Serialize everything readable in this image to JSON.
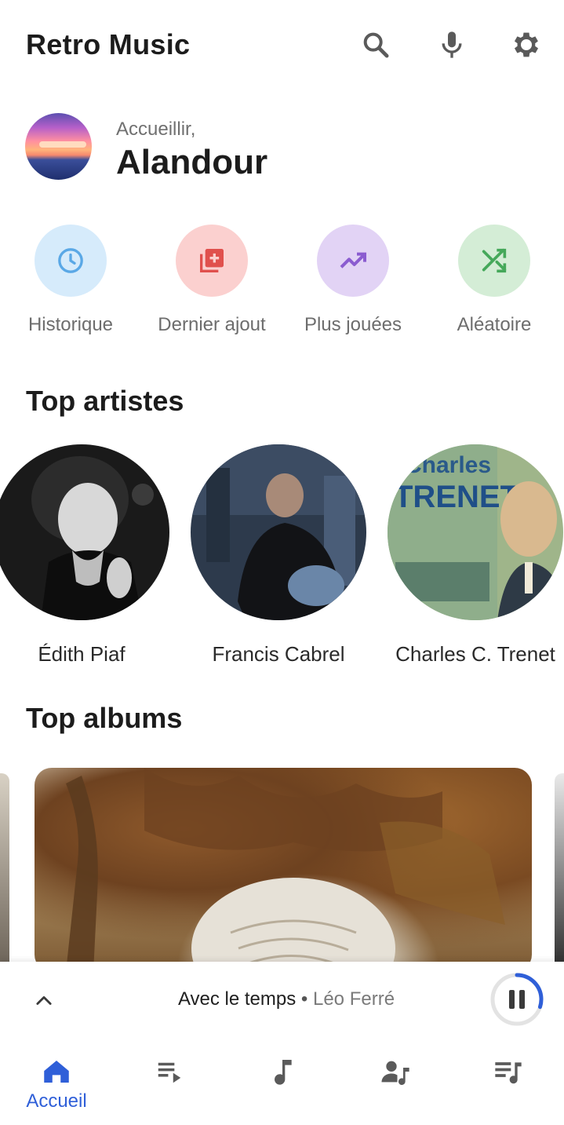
{
  "app": {
    "title": "Retro Music"
  },
  "header": {
    "icons": [
      "search-icon",
      "microphone-icon",
      "settings-gear-icon"
    ]
  },
  "greeting": {
    "subtitle": "Accueillir,",
    "name": "Alandour"
  },
  "quick_actions": [
    {
      "label": "Historique",
      "icon": "history-clock-icon",
      "bg": "#d6ebfb",
      "fg": "#5aa8e6"
    },
    {
      "label": "Dernier ajout",
      "icon": "library-add-icon",
      "bg": "#fbd0cf",
      "fg": "#e0504d"
    },
    {
      "label": "Plus jouées",
      "icon": "trending-up-icon",
      "bg": "#e2d3f5",
      "fg": "#8b5cd0"
    },
    {
      "label": "Aléatoire",
      "icon": "shuffle-icon",
      "bg": "#d4edd6",
      "fg": "#45a85a"
    }
  ],
  "top_artists": {
    "title": "Top artistes",
    "items": [
      {
        "name": "Édith Piaf"
      },
      {
        "name": "Francis Cabrel"
      },
      {
        "name": "Charles C. Trenet",
        "art_text": "Charles TRENET"
      }
    ]
  },
  "top_albums": {
    "title": "Top albums"
  },
  "now_playing": {
    "song": "Avec le temps",
    "separator": "•",
    "artist": "Léo Ferré",
    "progress": 0.3
  },
  "bottom_nav": {
    "items": [
      {
        "label": "Accueil",
        "icon": "home-icon",
        "active": true
      },
      {
        "label": "",
        "icon": "playlist-icon",
        "active": false
      },
      {
        "label": "",
        "icon": "music-note-icon",
        "active": false
      },
      {
        "label": "",
        "icon": "artist-icon",
        "active": false
      },
      {
        "label": "",
        "icon": "queue-music-icon",
        "active": false
      }
    ]
  },
  "colors": {
    "accent": "#2f5fd8",
    "icon_grey": "#5a5a5a"
  }
}
